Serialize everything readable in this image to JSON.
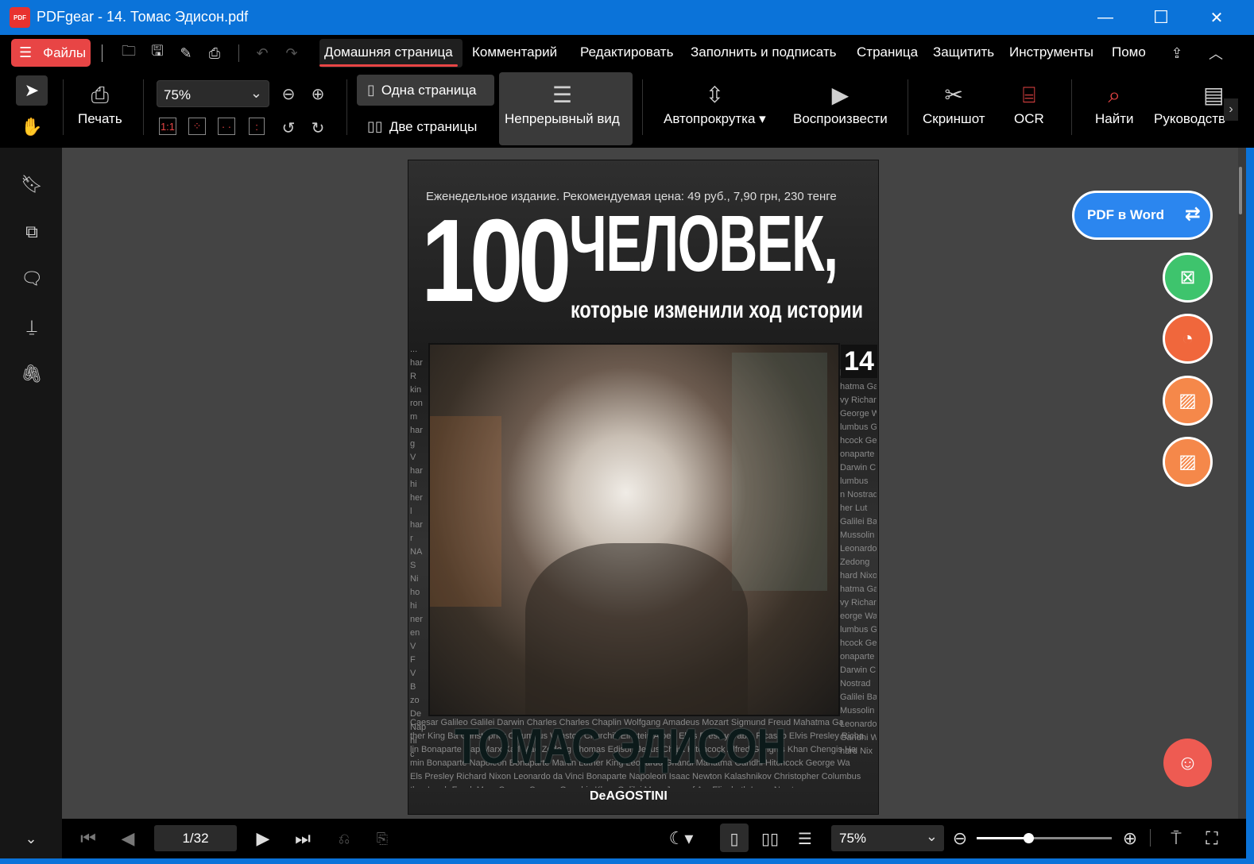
{
  "window": {
    "title": "PDFgear - 14. Томас Эдисон.pdf",
    "app_icon_text": "PDF",
    "minimize": "—",
    "maximize": "☐",
    "close": "✕"
  },
  "menubar": {
    "files_label": "Файлы",
    "items": [
      {
        "label": "Домашняя страница",
        "active": true
      },
      {
        "label": "Комментарий"
      },
      {
        "label": "Редактировать"
      },
      {
        "label": "Заполнить и подписать"
      },
      {
        "label": "Страница"
      },
      {
        "label": "Защитить"
      },
      {
        "label": "Инструменты"
      },
      {
        "label": "Помо"
      }
    ]
  },
  "ribbon": {
    "print_label": "Печать",
    "zoom_value": "75%",
    "one_page_label": "Одна страница",
    "two_pages_label": "Две страницы",
    "continuous_label": "Непрерывный вид",
    "autoscroll_label": "Автопрокрутка",
    "play_label": "Воспроизвести",
    "screenshot_label": "Скриншот",
    "ocr_label": "OCR",
    "find_label": "Найти",
    "guide_label": "Руководств",
    "actual_size_label": "1:1"
  },
  "document": {
    "cover": {
      "subtitle": "Еженедельное издание. Рекомендуемая цена: 49 руб., 7,90 грн, 230 тенге",
      "big_number": "100",
      "headline": "ЧЕЛОВЕК,",
      "tagline": "которые изменили ход истории",
      "issue_number": "14",
      "person_name": "ТОМАС ЭДИСОН",
      "publisher": "DeAGOSTINI",
      "names_left": "...\nhar\nR\nkin\nron\nm\nhar\ng\nV\nhar\nhi\nher\nl\nhar\nr\nNA\nS\nNi\nho\nhi\nner\nen\nV\nF\nV\nB\nzo\nDe\nNap\nhi\nc",
      "names_right": "hard Nixo\nhatma Gand\nvy Richar\nGeorge Wa\nlumbus Ge\nhcock Ge\nonaparte\nDarwin C\nlumbus\nn Nostrad\nher Lut\nGalilei Ba\nMussolin\nLeonardo\nZedong\nhard Nixo\nhatma Gand\nvy Richar\neorge Wa\nlumbus Ge\nhcock Ge\nonaparte\nDarwin C\nNostrad\nGalilei Ba\nMussolin\nLeonardo\nGandhi W\nhard Nix",
      "names_bottom": "Caesar Galileo Galilei Darwin Charles Charles Chaplin Wolfgang Amadeus Mozart Sigmund Freud Mahatma Ga\nther King Ba Christopher Columbus Winston Churchill Einstein Albert Elvis Presley Pablo Picasso Elvis Presley Richa\nlin Bonaparte Nap Marx Karl Mao Zedong Thomas Edison Jesus Christ Hitchcock Alfred Genghis Khan Chengis Ha\nmin Bonaparte Napoleon Bonaparte Martin Luther King Leonardo Ghandi Mahatma Gandhi Hitchcock George Wa\nEls Presley Richard Nixon Leonardo da Vinci Bonaparte Napoleon Isaac Newton Kalashnikov Christopher Columbus\nthur Lamb Frank Marx Caesar Caesar Genghis Khan Galilei Marx Joan of Arc Elizabeth Isaac Newton"
    }
  },
  "fabs": {
    "pdf_to_word_label": "PDF в Word"
  },
  "statusbar": {
    "page_indicator": "1/32",
    "zoom_value": "75%",
    "zoom_level": 0.38
  }
}
